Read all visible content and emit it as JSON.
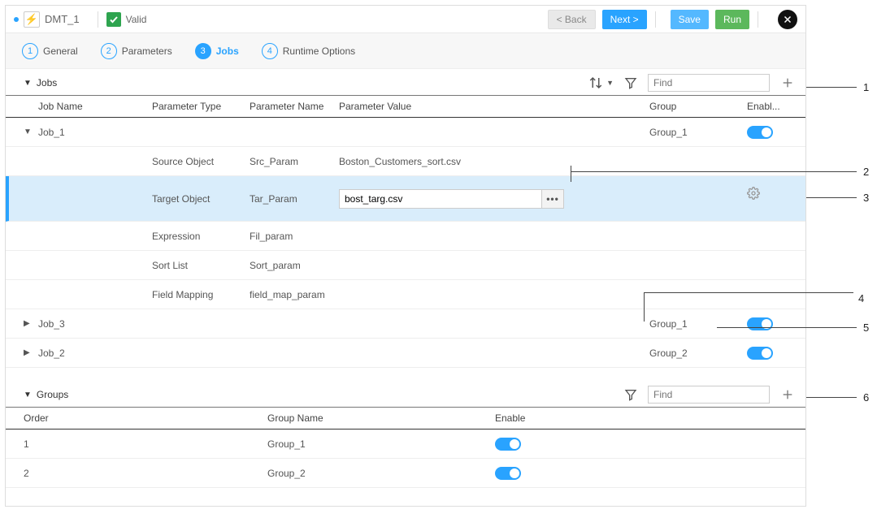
{
  "header": {
    "title": "DMT_1",
    "valid_label": "Valid",
    "buttons": {
      "back": "< Back",
      "next": "Next >",
      "save": "Save",
      "run": "Run"
    }
  },
  "wizard": {
    "steps": [
      {
        "num": "1",
        "label": "General"
      },
      {
        "num": "2",
        "label": "Parameters"
      },
      {
        "num": "3",
        "label": "Jobs"
      },
      {
        "num": "4",
        "label": "Runtime Options"
      }
    ],
    "active_index": 2
  },
  "jobs_section": {
    "title": "Jobs",
    "find_placeholder": "Find",
    "columns": {
      "job_name": "Job Name",
      "param_type": "Parameter Type",
      "param_name": "Parameter Name",
      "param_value": "Parameter Value",
      "group": "Group",
      "enabled": "Enabl..."
    },
    "jobs": [
      {
        "name": "Job_1",
        "group": "Group_1",
        "enabled": true,
        "expanded": true,
        "params": [
          {
            "type": "Source Object",
            "name": "Src_Param",
            "value": "Boston_Customers_sort.csv"
          },
          {
            "type": "Target Object",
            "name": "Tar_Param",
            "value": "bost_targ.csv",
            "selected": true
          },
          {
            "type": "Expression",
            "name": "Fil_param",
            "value": ""
          },
          {
            "type": "Sort List",
            "name": "Sort_param",
            "value": ""
          },
          {
            "type": "Field Mapping",
            "name": "field_map_param",
            "value": ""
          }
        ]
      },
      {
        "name": "Job_3",
        "group": "Group_1",
        "enabled": true,
        "expanded": false
      },
      {
        "name": "Job_2",
        "group": "Group_2",
        "enabled": true,
        "expanded": false
      }
    ]
  },
  "groups_section": {
    "title": "Groups",
    "find_placeholder": "Find",
    "columns": {
      "order": "Order",
      "group_name": "Group Name",
      "enable": "Enable"
    },
    "rows": [
      {
        "order": "1",
        "name": "Group_1",
        "enabled": true
      },
      {
        "order": "2",
        "name": "Group_2",
        "enabled": true
      }
    ]
  },
  "callouts": [
    "1",
    "2",
    "3",
    "4",
    "5",
    "6"
  ]
}
